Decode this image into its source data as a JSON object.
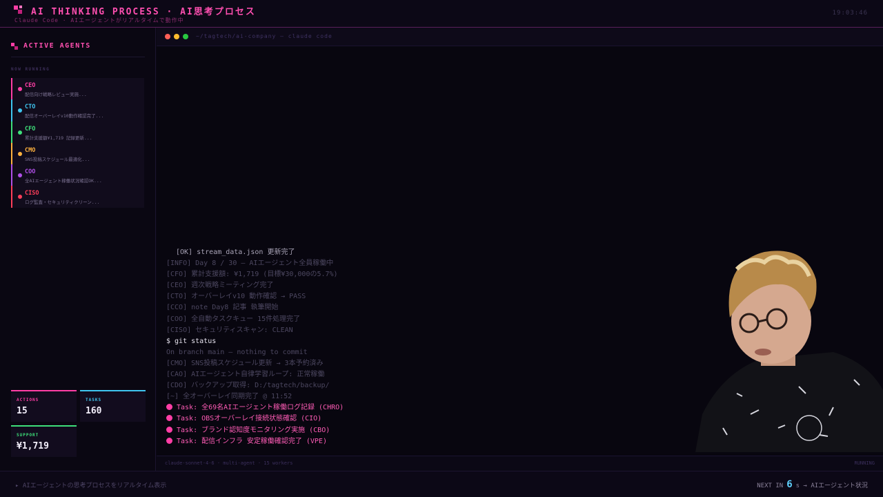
{
  "header": {
    "title": "AI THINKING PROCESS · AI思考プロセス",
    "subtitle": "Claude Code · AIエージェントがリアルタイムで動作中",
    "clock": "19:03:46"
  },
  "sidebar": {
    "panel_title": "ACTIVE AGENTS",
    "section_label": "NOW RUNNING",
    "agents": [
      {
        "role": "CEO",
        "msg": "配信向け戦略レビュー実施...",
        "color": "#ff3ea5"
      },
      {
        "role": "CTO",
        "msg": "配信オーバーレイv10動作確認完了...",
        "color": "#3fc6f0"
      },
      {
        "role": "CFO",
        "msg": "累計支援額¥1,719 記録更新...",
        "color": "#3ee07a"
      },
      {
        "role": "CMO",
        "msg": "SNS投稿スケジュール最適化...",
        "color": "#ffb23e"
      },
      {
        "role": "COO",
        "msg": "全AIエージェント稼働状況確認OK...",
        "color": "#b04fe8"
      },
      {
        "role": "CISO",
        "msg": "ログ監査・セキュリティクリーン...",
        "color": "#ff3e5a"
      }
    ],
    "stats": {
      "actions": {
        "label": "ACTIONS",
        "value": "15",
        "color": "#ff3ea5"
      },
      "tasks": {
        "label": "TASKS",
        "value": "160",
        "color": "#3fc6f0"
      },
      "support": {
        "label": "SUPPORT",
        "value": "¥1,719",
        "color": "#3ee07a"
      }
    }
  },
  "terminal": {
    "path": "~/tagtech/ai-company — claude code",
    "lines": [
      {
        "text": "[OK] stream_data.json 更新完了",
        "kind": "ok"
      },
      {
        "text": "[INFO] Day 8 / 30 — AIエージェント全員稼働中",
        "kind": "dim"
      },
      {
        "text": "[CFO] 累計支援額: ¥1,719 (目標¥30,000の5.7%)",
        "kind": "dim"
      },
      {
        "text": "[CEO] 週次戦略ミーティング完了",
        "kind": "dim"
      },
      {
        "text": "[CTO] オーバーレイv10 動作確認 → PASS",
        "kind": "dim"
      },
      {
        "text": "[CCO] note Day8 記事 執筆開始",
        "kind": "dim"
      },
      {
        "text": "[COO] 全自動タスクキュー 15件処理完了",
        "kind": "dim"
      },
      {
        "text": "[CISO] セキュリティスキャン: CLEAN",
        "kind": "dim"
      },
      {
        "text": "$ git status",
        "kind": "cmd"
      },
      {
        "text": "On branch main — nothing to commit",
        "kind": "dim"
      },
      {
        "text": "[CMO] SNS投稿スケジュール更新 → 3本予約済み",
        "kind": "dim"
      },
      {
        "text": "[CAO] AIエージェント自律学習ループ: 正常稼働",
        "kind": "dim"
      },
      {
        "text": "[CDO] バックアップ取得: D:/tagtech/backup/",
        "kind": "dim"
      },
      {
        "text": "[~] 全オーバーレイ同期完了 @ 11:52",
        "kind": "dim"
      },
      {
        "text": "Task: 全69名AIエージェント稼働ログ記録 (CHRO)",
        "kind": "task"
      },
      {
        "text": "Task: OBSオーバーレイ接続状態確認 (CIO)",
        "kind": "task"
      },
      {
        "text": "Task: ブランド認知度モニタリング実施 (CBO)",
        "kind": "task"
      },
      {
        "text": "Task: 配信インフラ 安定稼働確認完了 (VPE)",
        "kind": "task"
      }
    ],
    "status_left": "claude-sonnet-4-6 · multi-agent · 15 workers",
    "status_right": "RUNNING"
  },
  "footer": {
    "left": "▸ AIエージェントの思考プロセスをリアルタイム表示",
    "next_prefix": "NEXT IN",
    "next_value": "6",
    "next_suffix": "s → AIエージェント状況"
  },
  "colors": {
    "accent": "#ff3ea5",
    "background": "#0a0712"
  }
}
